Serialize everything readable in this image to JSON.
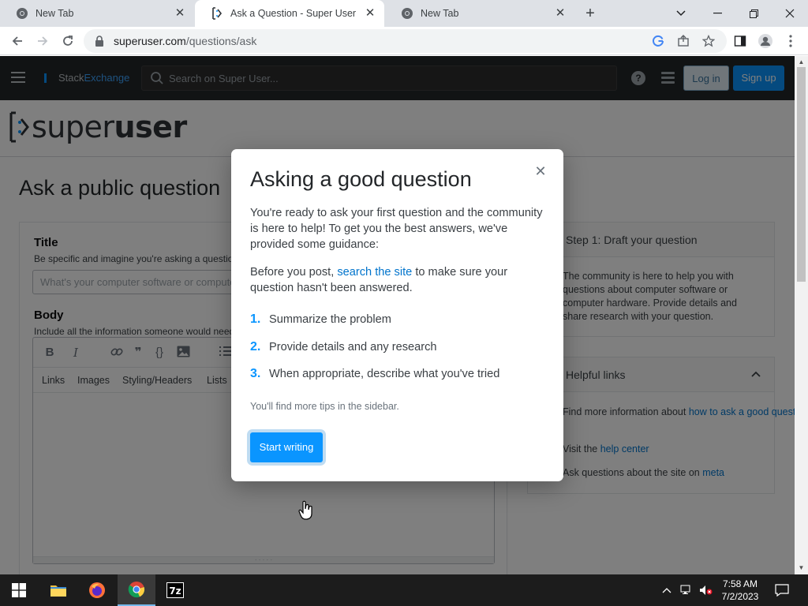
{
  "browser": {
    "tabs": [
      {
        "label": "New Tab",
        "active": false
      },
      {
        "label": "Ask a Question - Super User",
        "active": true
      },
      {
        "label": "New Tab",
        "active": false
      }
    ],
    "url_host": "superuser.com",
    "url_path": "/questions/ask"
  },
  "se_bar": {
    "logo_stack": "Stack",
    "logo_exchange": "Exchange",
    "search_placeholder": "Search on Super User...",
    "login": "Log in",
    "signup": "Sign up"
  },
  "site": {
    "logo_light": "super",
    "logo_bold": "user",
    "page_title": "Ask a public question"
  },
  "form": {
    "title_label": "Title",
    "title_desc": "Be specific and imagine you're asking a question to another person",
    "title_placeholder": "What's your computer software or computer hardware question?",
    "body_label": "Body",
    "body_desc": "Include all the information someone would need to answer your question",
    "help_links": [
      "Links",
      "Images",
      "Styling/Headers",
      "Lists"
    ]
  },
  "sidebar": {
    "draft_header": "Step 1: Draft your question",
    "draft_body": "The community is here to help you with questions about computer software or computer hardware. Provide details and share research with your question.",
    "links_header": "Helpful links",
    "link1_pre": "Find more information about ",
    "link1_a": "how to ask a good question here",
    "link2_pre": "Visit the ",
    "link2_a": "help center",
    "link3_pre": "Ask questions about the site on ",
    "link3_a": "meta"
  },
  "dialog": {
    "title": "Asking a good question",
    "intro": "You're ready to ask your first question and the community is here to help! To get you the best answers, we've provided some guidance:",
    "before_pre": "Before you post, ",
    "before_link": "search the site",
    "before_post": " to make sure your question hasn't been answered.",
    "steps": [
      {
        "num": "1.",
        "text": "Summarize the problem"
      },
      {
        "num": "2.",
        "text": "Provide details and any research"
      },
      {
        "num": "3.",
        "text": "When appropriate, describe what you've tried"
      }
    ],
    "tip": "You'll find more tips in the sidebar.",
    "start_label": "Start writing"
  },
  "taskbar": {
    "time": "7:58 AM",
    "date": "7/2/2023"
  }
}
